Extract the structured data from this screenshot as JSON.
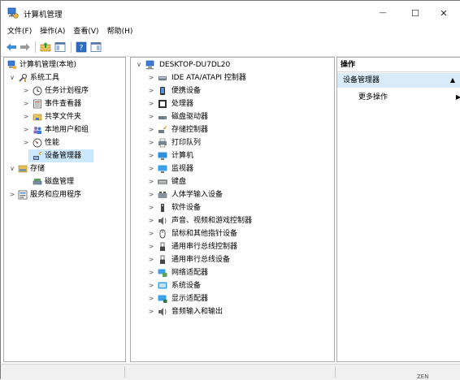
{
  "window": {
    "title": "计算机管理",
    "minimize": "—",
    "maximize": "☐",
    "close": "✕"
  },
  "menu": [
    "文件(F)",
    "操作(A)",
    "查看(V)",
    "帮助(H)"
  ],
  "left_tree": {
    "root": "计算机管理(本地)",
    "system_tools": "系统工具",
    "task_scheduler": "任务计划程序",
    "event_viewer": "事件查看器",
    "shared_folders": "共享文件夹",
    "local_users": "本地用户和组",
    "performance": "性能",
    "device_manager": "设备管理器",
    "storage": "存储",
    "disk_mgmt": "磁盘管理",
    "services": "服务和应用程序"
  },
  "devices": {
    "root": "DESKTOP-DU7DL20",
    "items": [
      "IDE ATA/ATAPI 控制器",
      "便携设备",
      "处理器",
      "磁盘驱动器",
      "存储控制器",
      "打印队列",
      "计算机",
      "监视器",
      "键盘",
      "人体学输入设备",
      "软件设备",
      "声音、视频和游戏控制器",
      "鼠标和其他指针设备",
      "通用串行总线控制器",
      "通用串行总线设备",
      "网络适配器",
      "系统设备",
      "显示适配器",
      "音频输入和输出"
    ]
  },
  "actions": {
    "header": "操作",
    "section": "设备管理器",
    "more": "更多操作"
  },
  "taskbar_fragment": "ZEN"
}
